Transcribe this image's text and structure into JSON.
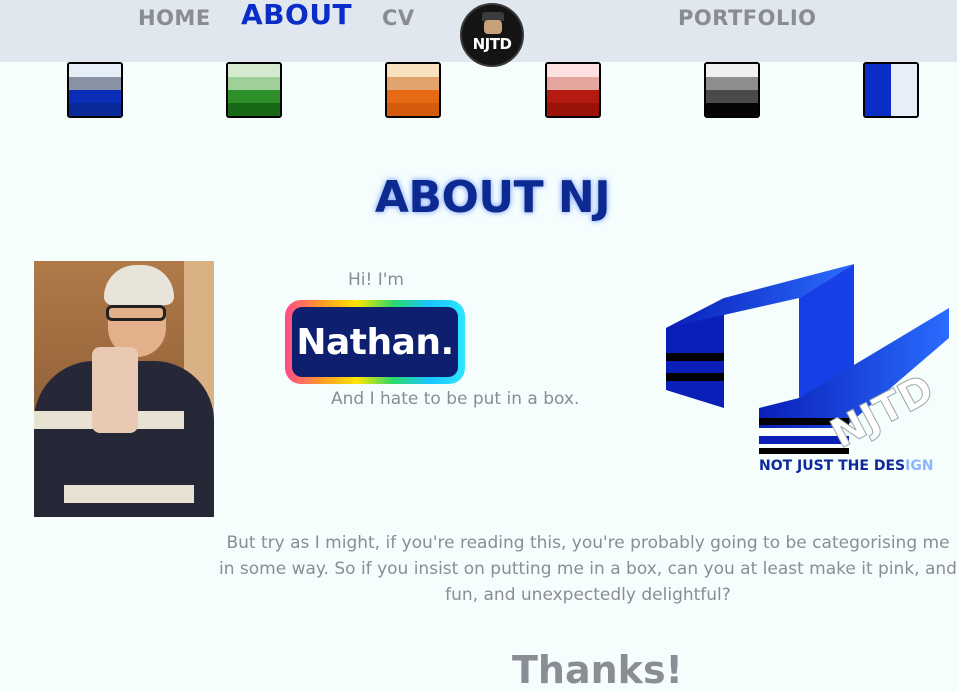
{
  "nav": {
    "home": "HOME",
    "about": "ABOUT",
    "cv": "CV",
    "portfolio": "PORTFOLIO",
    "logo_text": "NJTD"
  },
  "swatches": [
    {
      "name": "blue",
      "colors": [
        "#e6eef8",
        "#8a93a6",
        "#0b2db8",
        "#0a2a9a"
      ]
    },
    {
      "name": "green",
      "colors": [
        "#d4ebcf",
        "#9fd09a",
        "#2d8f2a",
        "#176817"
      ]
    },
    {
      "name": "orange",
      "colors": [
        "#f8e1bf",
        "#e2a46c",
        "#e66a14",
        "#d45a0c"
      ]
    },
    {
      "name": "red",
      "colors": [
        "#fde0e0",
        "#e6a6a0",
        "#b41a10",
        "#9a1208"
      ]
    },
    {
      "name": "grey",
      "colors": [
        "#f0f0f0",
        "#8e8e8e",
        "#4a4a4a",
        "#050505"
      ]
    },
    {
      "name": "blue-white",
      "colors": [
        "#0a2cc7",
        "#e6eef8"
      ]
    }
  ],
  "main": {
    "title": "ABOUT NJ",
    "hi": "Hi! I'm",
    "name": "Nathan.",
    "hate": "And I hate to be put in a box.",
    "tagline_main": "NOT JUST THE DES",
    "tagline_fade": "IGN",
    "logo_text": "NJTD",
    "paragraph": "But try as I might, if you're reading this, you're probably going to be categorising me in some way. So if you insist on putting me in a box, can you at least make it pink, and fun, and unexpectedly delightful?",
    "thanks": "Thanks!"
  },
  "colors": {
    "accent": "#0a2cc7",
    "nav_bg": "#e1e7ef",
    "text_muted": "#8b8d95",
    "title": "#0c2a8f"
  }
}
